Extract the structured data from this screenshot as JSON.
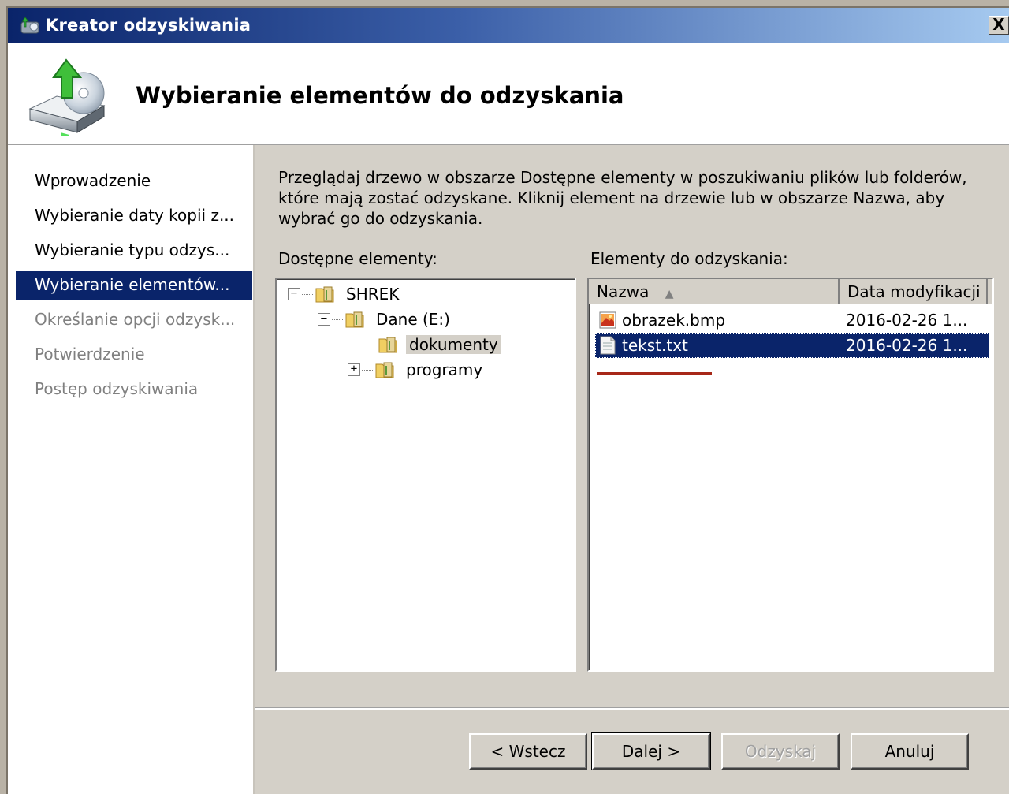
{
  "window": {
    "title": "Kreator odzyskiwania",
    "close_label": "X"
  },
  "header": {
    "title": "Wybieranie elementów do odzyskania",
    "icon": "backup-restore-icon"
  },
  "sidebar": {
    "items": [
      {
        "label": "Wprowadzenie",
        "state": "normal"
      },
      {
        "label": "Wybieranie daty kopii z...",
        "state": "normal"
      },
      {
        "label": "Wybieranie typu odzys...",
        "state": "normal"
      },
      {
        "label": "Wybieranie elementów...",
        "state": "selected"
      },
      {
        "label": "Określanie opcji odzysk...",
        "state": "disabled"
      },
      {
        "label": "Potwierdzenie",
        "state": "disabled"
      },
      {
        "label": "Postęp odzyskiwania",
        "state": "disabled"
      }
    ]
  },
  "main": {
    "description": "Przeglądaj drzewo w obszarze Dostępne elementy w poszukiwaniu plików lub folderów, które mają zostać odzyskane. Kliknij element na drzewie lub w obszarze Nazwa, aby wybrać go do odzyskania.",
    "available_label": "Dostępne elementy:",
    "recover_label": "Elementy do odzyskania:",
    "tree": [
      {
        "label": "SHREK",
        "expander": "−",
        "icon": "server-folder-icon"
      },
      {
        "label": "Dane (E:)",
        "expander": "−",
        "icon": "drive-folder-icon"
      },
      {
        "label": "dokumenty",
        "expander": "",
        "icon": "folder-icon",
        "highlighted": true
      },
      {
        "label": "programy",
        "expander": "+",
        "icon": "folder-icon"
      }
    ],
    "list": {
      "columns": {
        "name": "Nazwa",
        "sort_indicator": "▲",
        "date": "Data modyfikacji"
      },
      "rows": [
        {
          "name": "obrazek.bmp",
          "date": "2016-02-26 1...",
          "icon": "bitmap-file-icon"
        },
        {
          "name": "tekst.txt",
          "date": "2016-02-26 1...",
          "icon": "text-file-icon",
          "selected": true
        }
      ]
    }
  },
  "buttons": {
    "back": "< Wstecz",
    "next": "Dalej >",
    "recover": "Odzyskaj",
    "cancel": "Anuluj"
  },
  "colors": {
    "selection": "#0a246a",
    "annotation_underline": "#a72818"
  }
}
